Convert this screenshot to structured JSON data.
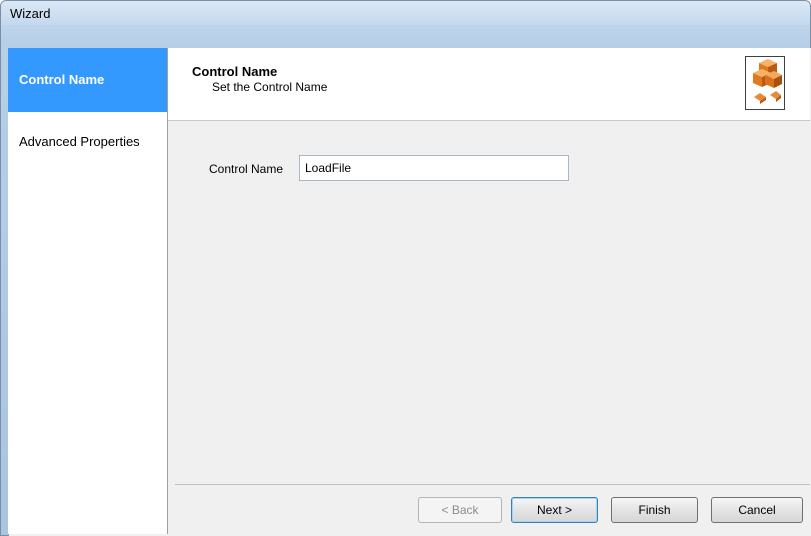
{
  "window": {
    "title": "Wizard"
  },
  "sidebar": {
    "items": [
      {
        "label": "Control Name"
      },
      {
        "label": "Advanced Properties"
      }
    ]
  },
  "header": {
    "title": "Control Name",
    "subtitle": "Set the Control Name",
    "icon": "orange-blocks-icon"
  },
  "form": {
    "control_name_label": "Control Name",
    "control_name_value": "LoadFile"
  },
  "buttons": {
    "back": "< Back",
    "next": "Next >",
    "finish": "Finish",
    "cancel": "Cancel"
  },
  "colors": {
    "selected_item_bg": "#3399ff",
    "icon_orange": "#e07a1f"
  }
}
